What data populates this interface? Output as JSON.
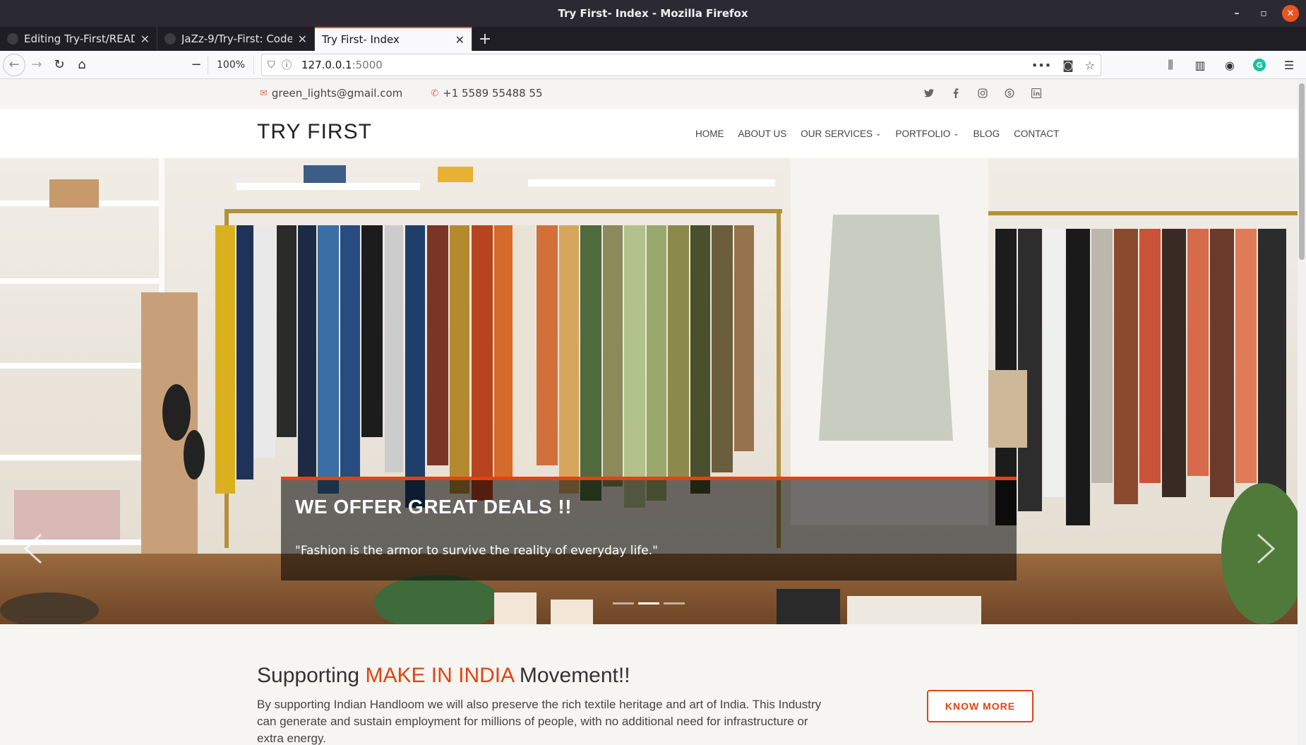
{
  "window": {
    "title": "Try First- Index - Mozilla Firefox"
  },
  "tabs": [
    {
      "label": "Editing Try-First/READM",
      "active": false
    },
    {
      "label": "JaZz-9/Try-First: Codes a",
      "active": false
    },
    {
      "label": "Try First- Index",
      "active": true
    }
  ],
  "toolbar": {
    "zoom": "100%",
    "url_host": "127.0.0.1",
    "url_port": ":5000"
  },
  "topbar": {
    "email": "green_lights@gmail.com",
    "phone": "+1 5589 55488 55",
    "social_icons": [
      "twitter-icon",
      "facebook-icon",
      "instagram-icon",
      "skype-icon",
      "linkedin-icon"
    ]
  },
  "header": {
    "logo": "TRY FIRST",
    "menu": [
      {
        "label": "HOME",
        "dropdown": false
      },
      {
        "label": "ABOUT US",
        "dropdown": false
      },
      {
        "label": "OUR SERVICES",
        "dropdown": true
      },
      {
        "label": "PORTFOLIO",
        "dropdown": true
      },
      {
        "label": "BLOG",
        "dropdown": false
      },
      {
        "label": "CONTACT",
        "dropdown": false
      }
    ]
  },
  "hero": {
    "title": "WE OFFER GREAT DEALS !!",
    "quote": "\"Fashion is the armor to survive the reality of everyday life.\"",
    "slides": 3,
    "active_slide": 2
  },
  "section": {
    "heading_pre": "Supporting ",
    "heading_accent": "MAKE IN INDIA",
    "heading_post": " Movement!!",
    "paragraph": "By supporting Indian Handloom we will also preserve the rich textile heritage and art of India. This Industry can generate and sustain employment for millions of people, with no additional need for infrastructure or extra energy.",
    "button": "KNOW MORE"
  },
  "colors": {
    "accent": "#e04412",
    "firefox_dark": "#2b2a33"
  }
}
